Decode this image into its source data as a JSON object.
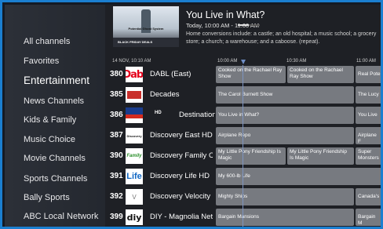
{
  "sidebar": {
    "items": [
      {
        "label": "All channels"
      },
      {
        "label": "Favorites"
      },
      {
        "label": "Entertainment"
      },
      {
        "label": "News Channels"
      },
      {
        "label": "Kids & Family"
      },
      {
        "label": "Music Choice"
      },
      {
        "label": "Movie Channels"
      },
      {
        "label": "Sports Channels"
      },
      {
        "label": "Bally Sports"
      },
      {
        "label": "ABC Local Network"
      }
    ],
    "active_index": 2
  },
  "now_playing": {
    "thumb_text": "Potential Ghost System",
    "thumb_deal": "BLACK FRIDAY DEALS",
    "title": "You Live in What?",
    "time": "Today, 10:00 AM - 11:00 AM",
    "progress": 0.5,
    "description": "Home conversions include: a castle; an old hospital; a music school; a grocery store; a church; a warehouse; and a caboose. (repeat)."
  },
  "guide": {
    "date": "14 NOV, 10:10 AM",
    "times": [
      "10:00 AM",
      "10:30 AM",
      "11:00 AM"
    ],
    "channels": [
      {
        "number": "380",
        "logo": "dabl-logo",
        "logo_text": "Dabl",
        "name": "DABL (East)",
        "hd": "",
        "programs": [
          {
            "title": "Cooked on the Rachael Ray Show"
          },
          {
            "title": "Cooked on the Rachael Ray Show"
          },
          {
            "title": "Real Pote"
          }
        ]
      },
      {
        "number": "385",
        "logo": "decades-logo",
        "logo_text": "",
        "name": "Decades",
        "hd": "",
        "programs": [
          {
            "title": "The Carol Burnett Show"
          },
          {
            "title": "The Lucy"
          }
        ]
      },
      {
        "number": "386",
        "logo": "destination-america-logo",
        "logo_text": "AMERICA",
        "name": "Destination",
        "hd": "HD",
        "programs": [
          {
            "title": "You Live in What?"
          },
          {
            "title": "You Live"
          }
        ]
      },
      {
        "number": "387",
        "logo": "discovery-logo",
        "logo_text": "Discovery",
        "name": "Discovery East HD",
        "hd": "",
        "programs": [
          {
            "title": "Airplane Repo"
          },
          {
            "title": "Airplane F"
          }
        ]
      },
      {
        "number": "390",
        "logo": "discovery-family-logo",
        "logo_text": "Family",
        "name": "Discovery Family Cha",
        "hd": "",
        "programs": [
          {
            "title": "My Little Pony Friendship Is Magic"
          },
          {
            "title": "My Little Pony Friendship Is Magic"
          },
          {
            "title": "Super Monsters"
          }
        ]
      },
      {
        "number": "391",
        "logo": "discovery-life-logo",
        "logo_text": "Life",
        "name": "Discovery Life HD",
        "hd": "",
        "programs": [
          {
            "title": "My 600-lb Life"
          }
        ]
      },
      {
        "number": "392",
        "logo": "discovery-velocity-logo",
        "logo_text": "V",
        "name": "Discovery Velocity",
        "hd": "",
        "programs": [
          {
            "title": "Mighty Ships"
          },
          {
            "title": "Canada's"
          }
        ]
      },
      {
        "number": "399",
        "logo": "diy-logo",
        "logo_text": "diy",
        "name": "DIY - Magnolia Netwo",
        "hd": "",
        "programs": [
          {
            "title": "Bargain Mansions"
          },
          {
            "title": "Bargain M"
          }
        ]
      }
    ]
  },
  "colors": {
    "accent": "#1b7fd0",
    "cell": "#777a80",
    "now_line": "#7d94c0"
  }
}
